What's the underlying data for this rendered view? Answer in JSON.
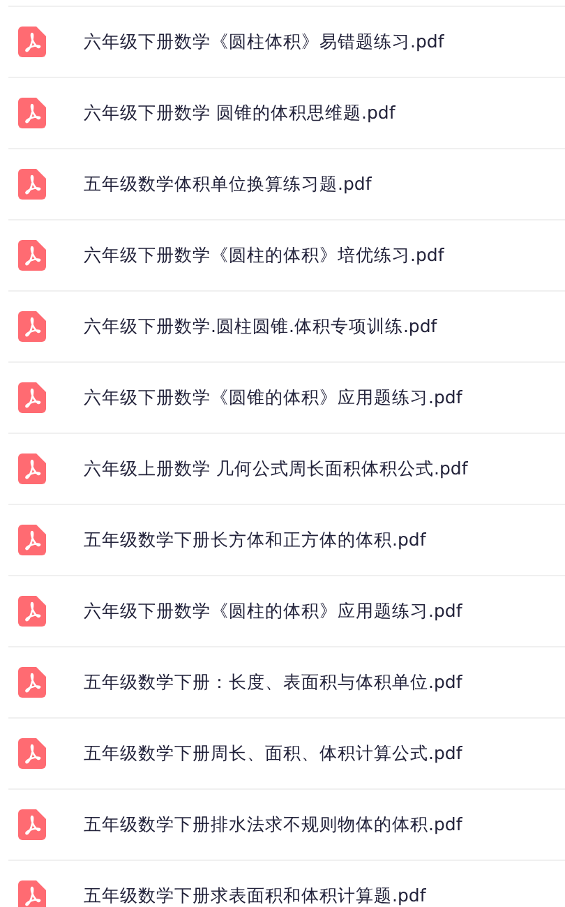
{
  "files": [
    {
      "name": "六年级下册数学《圆柱体积》易错题练习.pdf"
    },
    {
      "name": "六年级下册数学 圆锥的体积思维题.pdf"
    },
    {
      "name": "五年级数学体积单位换算练习题.pdf"
    },
    {
      "name": "六年级下册数学《圆柱的体积》培优练习.pdf"
    },
    {
      "name": "六年级下册数学.圆柱圆锥.体积专项训练.pdf"
    },
    {
      "name": "六年级下册数学《圆锥的体积》应用题练习.pdf"
    },
    {
      "name": "六年级上册数学 几何公式周长面积体积公式.pdf"
    },
    {
      "name": "五年级数学下册长方体和正方体的体积.pdf"
    },
    {
      "name": "六年级下册数学《圆柱的体积》应用题练习.pdf"
    },
    {
      "name": "五年级数学下册：长度、表面积与体积单位.pdf"
    },
    {
      "name": "五年级数学下册周长、面积、体积计算公式.pdf"
    },
    {
      "name": "五年级数学下册排水法求不规则物体的体积.pdf"
    },
    {
      "name": "五年级数学下册求表面积和体积计算题.pdf"
    }
  ]
}
